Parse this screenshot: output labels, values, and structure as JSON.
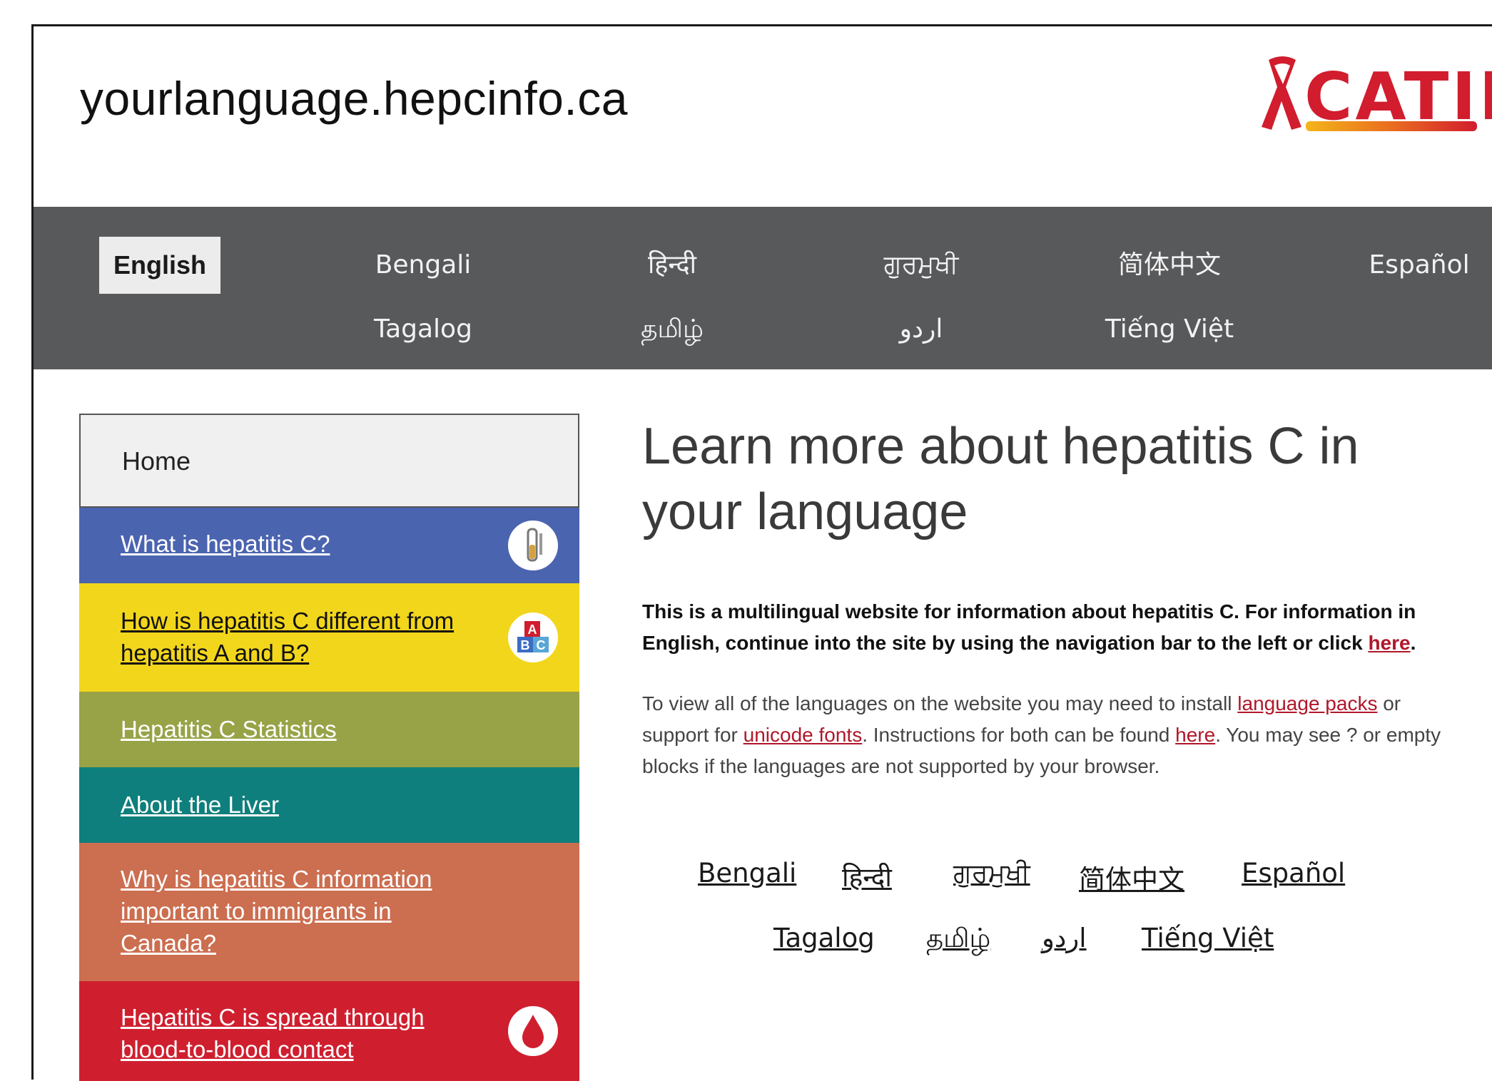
{
  "header": {
    "site_title": "yourlanguage.hepcinfo.ca",
    "logo_text": "CATIE"
  },
  "nav": {
    "items": [
      {
        "label": "English",
        "active": true
      },
      {
        "label": "Bengali"
      },
      {
        "label": "हिन्दी"
      },
      {
        "label": "ਗੁਰਮੁਖੀ"
      },
      {
        "label": "简体中文"
      },
      {
        "label": "Español"
      },
      {
        "label": "Tagalog"
      },
      {
        "label": "தமிழ்"
      },
      {
        "label": "اردو"
      },
      {
        "label": "Tiếng Việt"
      }
    ]
  },
  "sidebar": {
    "home_label": "Home",
    "items": [
      {
        "label": "What is hepatitis C?",
        "color": "#4b64b0",
        "icon": "test-tube-icon"
      },
      {
        "label": "How is hepatitis C different from hepatitis A and B?",
        "color": "#f2d61c",
        "icon": "abc-blocks-icon"
      },
      {
        "label": "Hepatitis C Statistics",
        "color": "#98a347"
      },
      {
        "label": "About the Liver",
        "color": "#0e7f7c"
      },
      {
        "label": "Why is hepatitis C information important to immigrants in Canada?",
        "color": "#cc6e50"
      },
      {
        "label": "Hepatitis C is spread through blood-to-blood contact",
        "color": "#cf1f2f",
        "icon": "blood-drop-icon"
      }
    ]
  },
  "main": {
    "heading": "Learn more about hepatitis C in your language",
    "para1_text": "This is a multilingual website for information about hepatitis C.  For information in English, continue into the site by using the navigation bar to the left or click ",
    "para1_link": "here",
    "para1_end": ".",
    "para2_a": "To view all of the languages on the website you may need to install ",
    "para2_link1": "language packs",
    "para2_b": " or support for ",
    "para2_link2": "unicode fonts",
    "para2_c": ".  Instructions for both can be found ",
    "para2_link3": "here",
    "para2_d": ". You may see ? or empty blocks if the languages are not supported by your browser."
  },
  "language_links": {
    "row1": [
      "Bengali",
      "हिन्दी",
      "ਗੁਰਮੁਖੀ",
      "简体中文",
      "Español"
    ],
    "row2": [
      "Tagalog",
      "தமிழ்",
      "اردو",
      "Tiếng Việt"
    ]
  }
}
